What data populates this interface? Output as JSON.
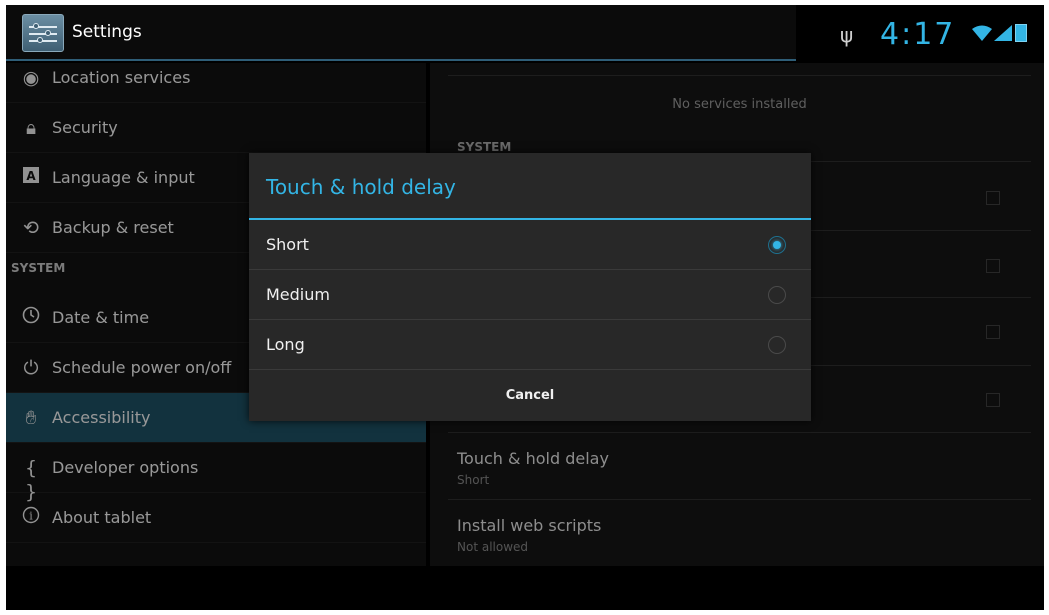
{
  "app": {
    "title": "Settings",
    "icon": "settings-sliders-icon"
  },
  "status_bar": {
    "time": "4:17",
    "icons": [
      "usb-icon",
      "wifi-icon",
      "signal-icon",
      "battery-charging-icon"
    ]
  },
  "left_menu": {
    "items_top": [
      {
        "label": "Location services",
        "icon": "location-icon"
      },
      {
        "label": "Security",
        "icon": "lock-icon"
      },
      {
        "label": "Language & input",
        "icon": "keyboard-a-icon"
      },
      {
        "label": "Backup & reset",
        "icon": "backup-icon"
      }
    ],
    "section_header": "SYSTEM",
    "items_system": [
      {
        "label": "Date & time",
        "icon": "clock-icon"
      },
      {
        "label": "Schedule power on/off",
        "icon": "power-schedule-icon"
      },
      {
        "label": "Accessibility",
        "icon": "hand-icon",
        "selected": true
      },
      {
        "label": "Developer options",
        "icon": "braces-icon"
      },
      {
        "label": "About tablet",
        "icon": "info-icon"
      }
    ]
  },
  "right_panel": {
    "no_services": "No services installed",
    "section_header": "SYSTEM",
    "touch_hold": {
      "title": "Touch & hold delay",
      "summary": "Short"
    },
    "web_scripts": {
      "title": "Install web scripts",
      "summary": "Not allowed"
    }
  },
  "dialog": {
    "title": "Touch & hold delay",
    "options": [
      {
        "label": "Short",
        "checked": true
      },
      {
        "label": "Medium",
        "checked": false
      },
      {
        "label": "Long",
        "checked": false
      }
    ],
    "cancel_label": "Cancel"
  },
  "colors": {
    "accent": "#33b5e5",
    "selected_row": "#1b4a5c",
    "dialog_bg": "#282828"
  }
}
